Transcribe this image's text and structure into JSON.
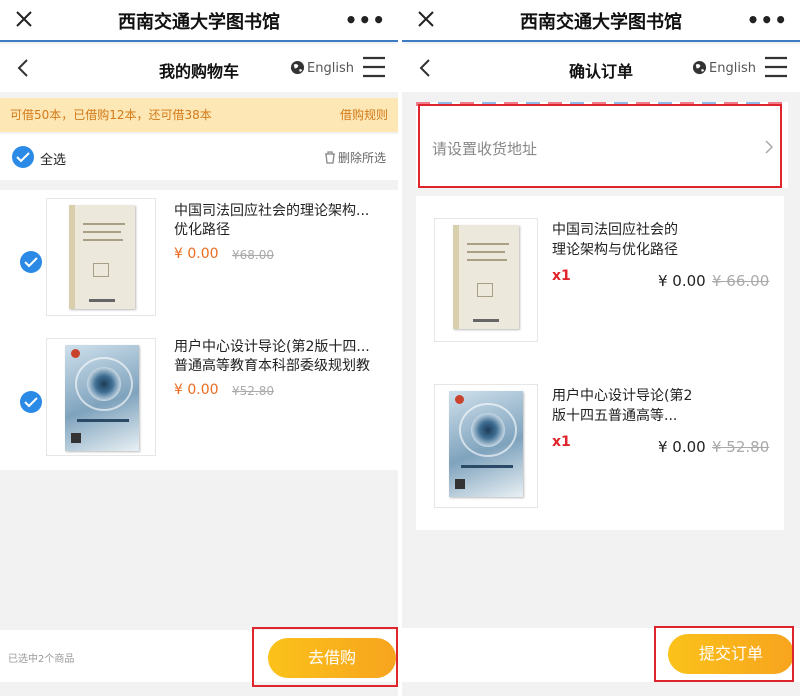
{
  "left": {
    "window_title": "西南交通大学图书馆",
    "page_title": "我的购物车",
    "language": "English",
    "notice": {
      "text": "可借50本，已借购12本，还可借38本",
      "rules_link": "借购规则"
    },
    "select_all_label": "全选",
    "delete_selected_label": "删除所选",
    "items": [
      {
        "title_line1": "中国司法回应社会的理论架构...",
        "title_line2": "优化路径",
        "price": "¥ 0.00",
        "original_price": "¥68.00"
      },
      {
        "title_line1": "用户中心设计导论(第2版十四...",
        "title_line2": "普通高等教育本科部委级规划教",
        "price": "¥ 0.00",
        "original_price": "¥52.80"
      }
    ],
    "selected_count_text": "已选中2个商品",
    "submit_label": "去借购"
  },
  "right": {
    "window_title": "西南交通大学图书馆",
    "page_title": "确认订单",
    "language": "English",
    "address_placeholder": "请设置收货地址",
    "items": [
      {
        "title_line1": "中国司法回应社会的",
        "title_line2": "理论架构与优化路径",
        "quantity": "x1",
        "price": "¥ 0.00",
        "original_price": "¥ 66.00"
      },
      {
        "title_line1": "用户中心设计导论(第2",
        "title_line2": "版十四五普通高等...",
        "quantity": "x1",
        "price": "¥ 0.00",
        "original_price": "¥ 52.80"
      }
    ],
    "submit_label": "提交订单"
  },
  "colors": {
    "accent_blue": "#2b8ae6",
    "price_orange": "#ec6b1f",
    "button_gradient_start": "#fbc21a",
    "button_gradient_end": "#f7a41e",
    "notice_bg": "#fde7b4",
    "annotation_red": "#e0242b"
  },
  "icons": [
    "close-icon",
    "more-icon",
    "back-icon",
    "globe-icon",
    "menu-icon",
    "check-icon",
    "trash-icon",
    "chevron-right-icon"
  ]
}
